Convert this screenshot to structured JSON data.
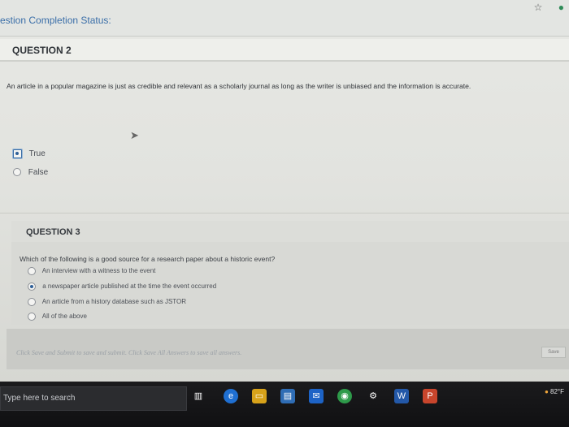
{
  "header": {
    "title": "estion Completion Status:"
  },
  "question2": {
    "label": "QUESTION 2",
    "text": "An article in a popular magazine is just as credible and relevant as a scholarly journal as long as the writer is unbiased and the information is accurate.",
    "options": [
      {
        "label": "True",
        "selected": true
      },
      {
        "label": "False",
        "selected": false
      }
    ]
  },
  "question3": {
    "label": "QUESTION 3",
    "text": "Which of the following is a good source for a research paper about a historic event?",
    "options": [
      {
        "label": "An interview with a witness to the event",
        "selected": false
      },
      {
        "label": "a newspaper article published at the time the event occurred",
        "selected": true
      },
      {
        "label": "An article from a history database such as JSTOR",
        "selected": false
      },
      {
        "label": "All of the above",
        "selected": false
      }
    ]
  },
  "footer": {
    "instruction": "Click Save and Submit to save and submit. Click Save All Answers to save all answers.",
    "save_label": "Save"
  },
  "taskbar": {
    "search_placeholder": "Type here to search",
    "temperature": "82°F"
  },
  "icons": {
    "task_view": "task-view-icon",
    "edge": "edge-icon",
    "file_explorer": "file-explorer-icon",
    "store": "store-icon",
    "mail": "mail-icon",
    "chrome": "chrome-icon",
    "settings": "gear-icon",
    "word": "word-icon",
    "powerpoint": "powerpoint-icon"
  }
}
